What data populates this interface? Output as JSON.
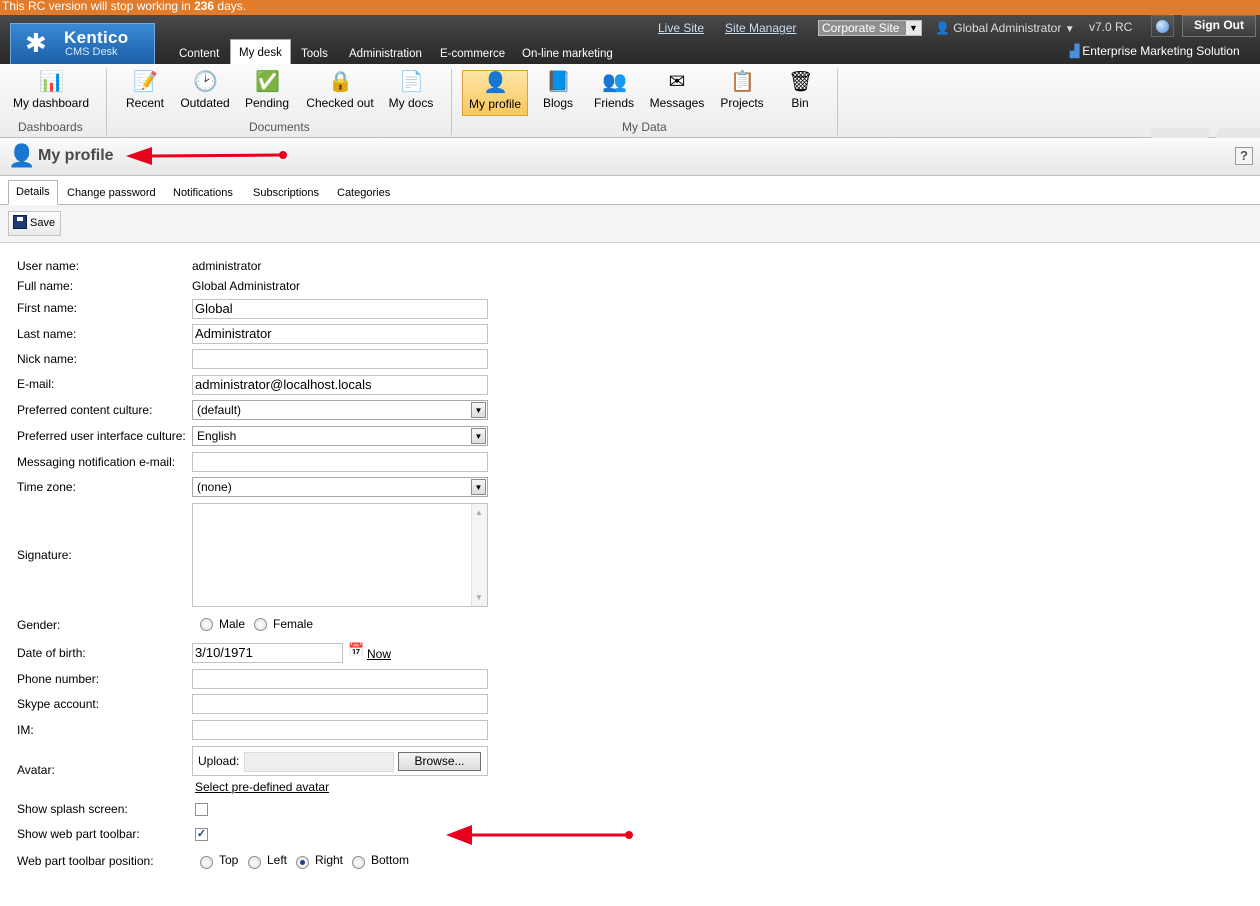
{
  "notice": {
    "prefix": "This RC version will stop working in ",
    "days": "236",
    "suffix": " days."
  },
  "header": {
    "logo_text": "Kentico",
    "logo_sub": "CMS Desk",
    "tabs": [
      "Content",
      "My desk",
      "Tools",
      "Administration",
      "E-commerce",
      "On-line marketing"
    ],
    "active_tab": "My desk",
    "links": {
      "live_site": "Live Site",
      "site_manager": "Site Manager"
    },
    "site_select": "Corporate Site",
    "user": "Global Administrator",
    "version": "v7.0 RC",
    "sign_out": "Sign Out",
    "edition": "Enterprise Marketing Solution"
  },
  "ribbon": {
    "groups": [
      {
        "name": "Dashboards",
        "items": [
          {
            "label": "My dashboard",
            "icon": "dashboard-icon"
          }
        ]
      },
      {
        "name": "Documents",
        "items": [
          {
            "label": "Recent",
            "icon": "recent-docs-icon"
          },
          {
            "label": "Outdated",
            "icon": "outdated-docs-icon"
          },
          {
            "label": "Pending",
            "icon": "pending-docs-icon"
          },
          {
            "label": "Checked out",
            "icon": "checked-out-icon"
          },
          {
            "label": "My docs",
            "icon": "my-docs-icon"
          }
        ]
      },
      {
        "name": "My Data",
        "items": [
          {
            "label": "My profile",
            "icon": "profile-icon",
            "active": true
          },
          {
            "label": "Blogs",
            "icon": "blogs-icon"
          },
          {
            "label": "Friends",
            "icon": "friends-icon"
          },
          {
            "label": "Messages",
            "icon": "messages-icon"
          },
          {
            "label": "Projects",
            "icon": "projects-icon"
          },
          {
            "label": "Bin",
            "icon": "bin-icon"
          }
        ]
      }
    ]
  },
  "page_title": "My profile",
  "help": "?",
  "subtabs": [
    "Details",
    "Change password",
    "Notifications",
    "Subscriptions",
    "Categories"
  ],
  "active_subtab": "Details",
  "toolbar": {
    "save_label": "Save"
  },
  "form": {
    "user_name": {
      "label": "User name:",
      "value": "administrator"
    },
    "full_name": {
      "label": "Full name:",
      "value": "Global Administrator"
    },
    "first_name": {
      "label": "First name:",
      "value": "Global"
    },
    "last_name": {
      "label": "Last name:",
      "value": "Administrator"
    },
    "nick_name": {
      "label": "Nick name:",
      "value": ""
    },
    "email": {
      "label": "E-mail:",
      "value": "administrator@localhost.locals"
    },
    "content_culture": {
      "label": "Preferred content culture:",
      "value": "(default)"
    },
    "ui_culture": {
      "label": "Preferred user interface culture:",
      "value": "English"
    },
    "messaging_email": {
      "label": "Messaging notification e-mail:",
      "value": ""
    },
    "time_zone": {
      "label": "Time zone:",
      "value": "(none)"
    },
    "signature": {
      "label": "Signature:",
      "value": ""
    },
    "gender": {
      "label": "Gender:",
      "options": [
        "Male",
        "Female"
      ],
      "selected": null
    },
    "dob": {
      "label": "Date of birth:",
      "value": "3/10/1971",
      "now_link": "Now"
    },
    "phone": {
      "label": "Phone number:",
      "value": ""
    },
    "skype": {
      "label": "Skype account:",
      "value": ""
    },
    "im": {
      "label": "IM:",
      "value": ""
    },
    "avatar": {
      "label": "Avatar:",
      "upload_label": "Upload:",
      "browse": "Browse...",
      "predefined_link": "Select pre-defined avatar"
    },
    "splash": {
      "label": "Show splash screen:",
      "checked": false
    },
    "webpart_toolbar": {
      "label": "Show web part toolbar:",
      "checked": true
    },
    "toolbar_position": {
      "label": "Web part toolbar position:",
      "options": [
        "Top",
        "Left",
        "Right",
        "Bottom"
      ],
      "selected": "Right"
    }
  },
  "colors": {
    "notice_bar": "#e07c2b",
    "header": "#333333",
    "annotation_arrow": "#e8001c",
    "active_ribbon": "#f8c75c"
  }
}
